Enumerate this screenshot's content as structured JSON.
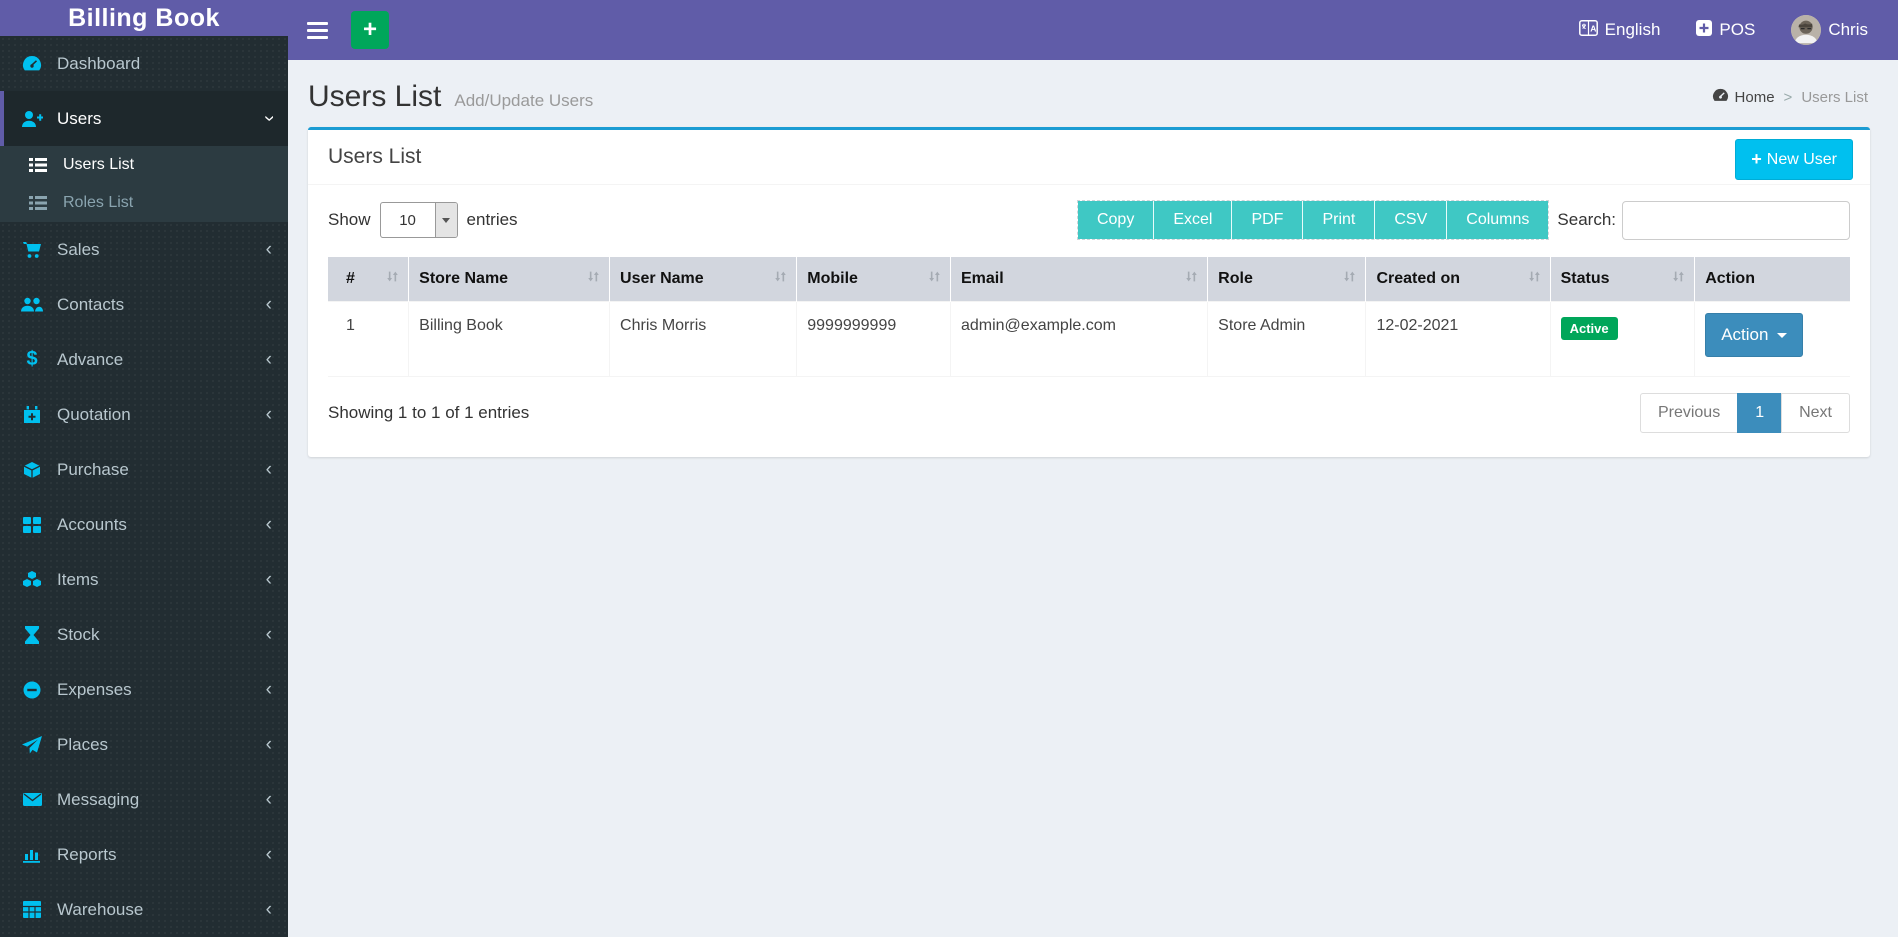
{
  "app": {
    "title": "Billing Book"
  },
  "topbar": {
    "language_label": "English",
    "pos_label": "POS",
    "user_name": "Chris",
    "quick_add_glyph": "+"
  },
  "sidebar": {
    "items": [
      {
        "label": "Dashboard",
        "icon": "gauge-icon"
      },
      {
        "label": "Users",
        "icon": "user-plus-icon",
        "expanded": true,
        "active": true,
        "children": [
          {
            "label": "Users List",
            "icon": "list-icon",
            "active": true
          },
          {
            "label": "Roles List",
            "icon": "list-icon",
            "active": false
          }
        ]
      },
      {
        "label": "Sales",
        "icon": "cart-icon"
      },
      {
        "label": "Contacts",
        "icon": "users-icon"
      },
      {
        "label": "Advance",
        "icon": "dollar-icon",
        "glyph": "$"
      },
      {
        "label": "Quotation",
        "icon": "calendar-plus-icon"
      },
      {
        "label": "Purchase",
        "icon": "cube-icon"
      },
      {
        "label": "Accounts",
        "icon": "th-large-icon"
      },
      {
        "label": "Items",
        "icon": "cubes-icon"
      },
      {
        "label": "Stock",
        "icon": "hourglass-icon"
      },
      {
        "label": "Expenses",
        "icon": "minus-circle-icon"
      },
      {
        "label": "Places",
        "icon": "paper-plane-icon"
      },
      {
        "label": "Messaging",
        "icon": "envelope-icon"
      },
      {
        "label": "Reports",
        "icon": "bar-chart-icon"
      },
      {
        "label": "Warehouse",
        "icon": "table-icon"
      }
    ],
    "chevron_glyph": "‹"
  },
  "page": {
    "title": "Users List",
    "subtitle": "Add/Update Users",
    "breadcrumb": {
      "home": "Home",
      "separator": ">",
      "current": "Users List"
    }
  },
  "card": {
    "title": "Users List",
    "new_user_label": "New User",
    "new_user_plus_glyph": "+"
  },
  "toolbar": {
    "show_label": "Show",
    "page_size": "10",
    "entries_label": "entries",
    "export_buttons": [
      "Copy",
      "Excel",
      "PDF",
      "Print",
      "CSV",
      "Columns"
    ],
    "search_label": "Search:",
    "search_value": ""
  },
  "table": {
    "columns": [
      {
        "label": "#",
        "sortable": true
      },
      {
        "label": "Store Name",
        "sortable": true
      },
      {
        "label": "User Name",
        "sortable": true
      },
      {
        "label": "Mobile",
        "sortable": true
      },
      {
        "label": "Email",
        "sortable": true
      },
      {
        "label": "Role",
        "sortable": true
      },
      {
        "label": "Created on",
        "sortable": true
      },
      {
        "label": "Status",
        "sortable": true
      },
      {
        "label": "Action",
        "sortable": false
      }
    ],
    "rows": [
      {
        "index": "1",
        "store_name": "Billing Book",
        "user_name": "Chris Morris",
        "mobile": "9999999999",
        "email": "admin@example.com",
        "role": "Store Admin",
        "created_on": "12-02-2021",
        "status": "Active",
        "action_label": "Action"
      }
    ]
  },
  "table_footer": {
    "info": "Showing 1 to 1 of 1 entries",
    "pagination": {
      "previous": "Previous",
      "page": "1",
      "next": "Next",
      "active_page": "1"
    }
  },
  "colors": {
    "header_purple": "#605ca8",
    "sidebar_dark": "#222d32",
    "icon_cyan": "#00c0ef",
    "card_top_border": "#1b9cd3",
    "export_teal": "#3fc8c4",
    "primary_blue": "#3c8dbc",
    "success_green": "#00a65a",
    "table_header_gray": "#d2d6de",
    "content_bg": "#ecf0f5"
  }
}
